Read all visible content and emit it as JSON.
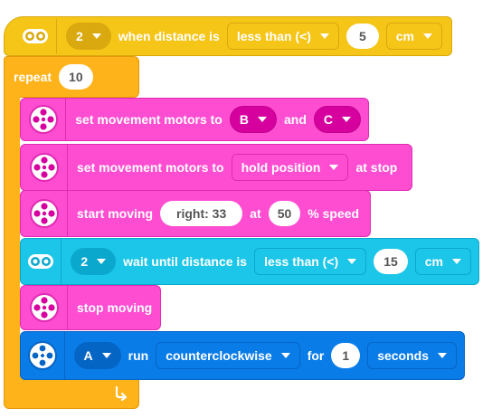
{
  "hat": {
    "sensor_port": "2",
    "label": "when distance is",
    "comparison": "less than (<)",
    "value": "5",
    "unit": "cm"
  },
  "repeat": {
    "label": "repeat",
    "count": "10"
  },
  "blocks": {
    "b1": {
      "label": "set movement motors to",
      "port_a": "B",
      "and_label": "and",
      "port_b": "C"
    },
    "b2": {
      "label": "set movement motors to",
      "option": "hold position",
      "suffix": "at stop"
    },
    "b3": {
      "label": "start moving",
      "direction": "right: 33",
      "at_label": "at",
      "speed": "50",
      "suffix": "% speed"
    },
    "b4": {
      "sensor_port": "2",
      "label": "wait until distance is",
      "comparison": "less than (<)",
      "value": "15",
      "unit": "cm"
    },
    "b5": {
      "label": "stop moving"
    },
    "b6": {
      "port": "A",
      "run_label": "run",
      "direction": "counterclockwise",
      "for_label": "for",
      "amount": "1",
      "unit": "seconds"
    }
  },
  "colors": {
    "events": "#f5c518",
    "control": "#ffb31a",
    "movement": "#ff4dd2",
    "sensors": "#1cc6e8",
    "motors": "#0a7ce8"
  }
}
